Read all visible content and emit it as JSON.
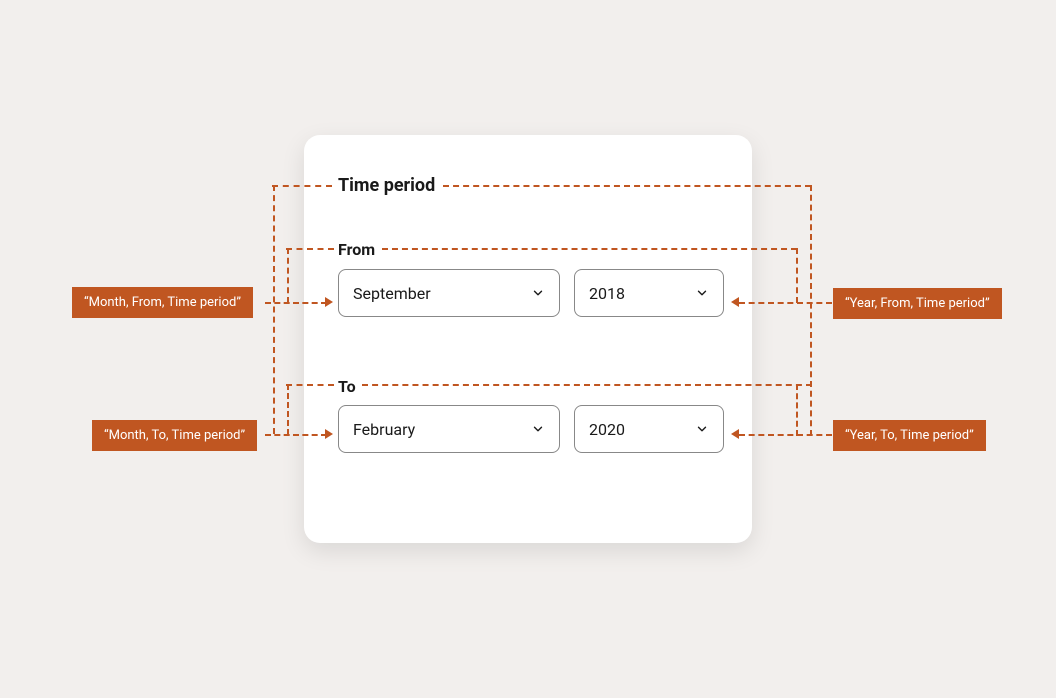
{
  "card": {
    "title": "Time period",
    "from": {
      "label": "From",
      "month": "September",
      "year": "2018"
    },
    "to": {
      "label": "To",
      "month": "February",
      "year": "2020"
    }
  },
  "annotations": {
    "monthFrom": "“Month, From, Time period”",
    "yearFrom": "“Year, From, Time period”",
    "monthTo": "“Month, To, Time period”",
    "yearTo": "“Year, To, Time period”"
  },
  "colors": {
    "accent": "#c05621",
    "cardBg": "#ffffff",
    "pageBg": "#f2efed"
  }
}
